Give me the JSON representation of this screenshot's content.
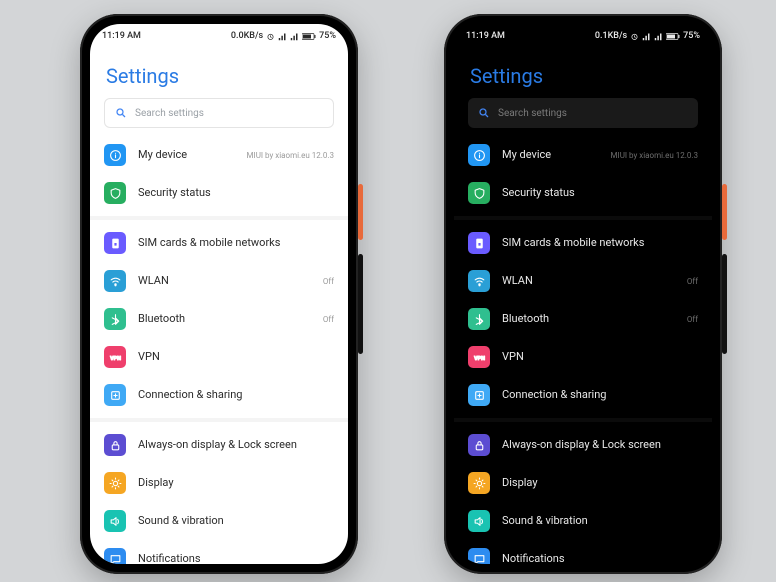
{
  "status": {
    "time": "11:19 AM",
    "net_left": "0.0KB/s",
    "net_right": "0.1KB/s",
    "battery": "75"
  },
  "title": "Settings",
  "search": {
    "placeholder": "Search settings"
  },
  "items": [
    {
      "id": "my-device",
      "label": "My device",
      "meta": "MIUI by xiaomi.eu 12.0.3",
      "color": "c-blue",
      "icon": "info"
    },
    {
      "id": "security",
      "label": "Security status",
      "meta": "",
      "color": "c-green",
      "icon": "shield",
      "sep_after": true
    },
    {
      "id": "sim",
      "label": "SIM cards & mobile networks",
      "meta": "",
      "color": "c-purple",
      "icon": "sim"
    },
    {
      "id": "wlan",
      "label": "WLAN",
      "meta": "Off",
      "color": "c-cyan",
      "icon": "wifi"
    },
    {
      "id": "bt",
      "label": "Bluetooth",
      "meta": "Off",
      "color": "c-teal",
      "icon": "bt"
    },
    {
      "id": "vpn",
      "label": "VPN",
      "meta": "",
      "color": "c-pink",
      "icon": "vpn"
    },
    {
      "id": "connshare",
      "label": "Connection & sharing",
      "meta": "",
      "color": "c-sky",
      "icon": "share",
      "sep_after": true
    },
    {
      "id": "aod",
      "label": "Always-on display & Lock screen",
      "meta": "",
      "color": "c-purple2",
      "icon": "lock"
    },
    {
      "id": "display",
      "label": "Display",
      "meta": "",
      "color": "c-orange",
      "icon": "sun"
    },
    {
      "id": "sound",
      "label": "Sound & vibration",
      "meta": "",
      "color": "c-mint",
      "icon": "speaker"
    },
    {
      "id": "notif",
      "label": "Notifications",
      "meta": "",
      "color": "c-azure",
      "icon": "chat"
    }
  ]
}
